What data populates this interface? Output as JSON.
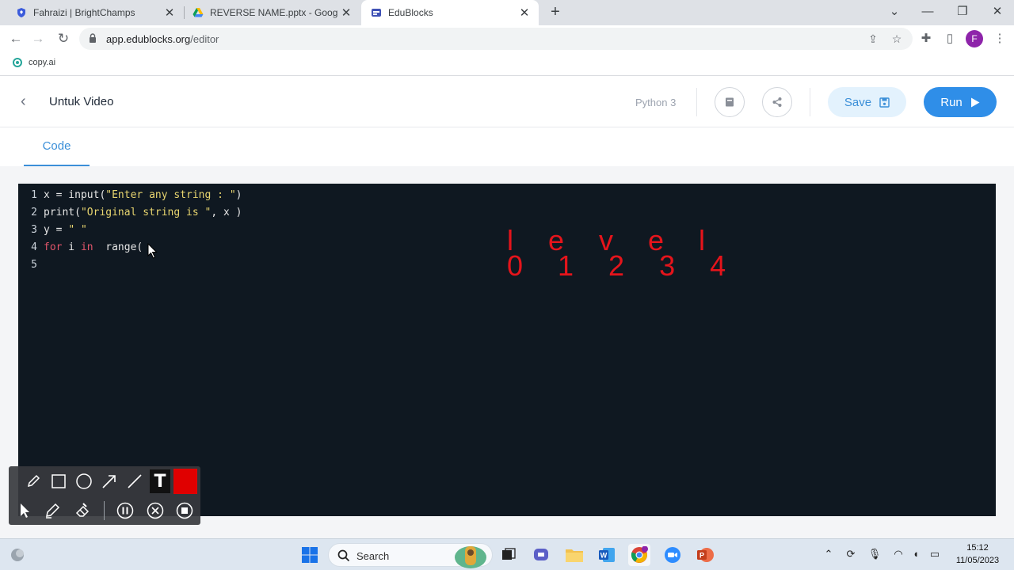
{
  "browser": {
    "tabs": [
      {
        "title": "Fahraizi | BrightChamps",
        "icon": "shield-icon",
        "active": false
      },
      {
        "title": "REVERSE NAME.pptx - Google Dr",
        "icon": "google-drive-icon",
        "active": false
      },
      {
        "title": "EduBlocks",
        "icon": "edublocks-icon",
        "active": true
      }
    ],
    "url_host": "app.edublocks.org",
    "url_path": "/editor",
    "profile_initial": "F",
    "bookmarks": [
      {
        "label": "copy.ai",
        "icon": "copyai-icon"
      }
    ]
  },
  "app": {
    "project_title": "Untuk Video",
    "language": "Python 3",
    "save_label": "Save",
    "run_label": "Run",
    "tabs": [
      {
        "label": "Code",
        "active": true
      }
    ],
    "accent_color": "#2f8ee8"
  },
  "editor": {
    "lines": [
      {
        "num": "1",
        "tokens": [
          {
            "t": "x = input(",
            "c": "plain"
          },
          {
            "t": "\"Enter any string : \"",
            "c": "str"
          },
          {
            "t": ")",
            "c": "plain"
          }
        ]
      },
      {
        "num": "2",
        "tokens": [
          {
            "t": "print(",
            "c": "plain"
          },
          {
            "t": "\"Original string is \"",
            "c": "str"
          },
          {
            "t": ", x )",
            "c": "plain"
          }
        ]
      },
      {
        "num": "3",
        "tokens": [
          {
            "t": "y = ",
            "c": "plain"
          },
          {
            "t": "\" \"",
            "c": "str"
          }
        ]
      },
      {
        "num": "4",
        "tokens": [
          {
            "t": "for",
            "c": "kw"
          },
          {
            "t": " i ",
            "c": "plain"
          },
          {
            "t": "in",
            "c": "kw"
          },
          {
            "t": "  range(",
            "c": "plain"
          }
        ]
      },
      {
        "num": "5",
        "tokens": []
      }
    ]
  },
  "annotation": {
    "word": "l e v e l",
    "indices": "0 1 2 3 4",
    "color": "#e5141b"
  },
  "draw_toolbar": {
    "tools_row1": [
      "pencil-icon",
      "rectangle-icon",
      "circle-icon",
      "arrow-icon",
      "line-icon",
      "text-icon",
      "color-swatch"
    ],
    "tools_row2": [
      "pointer-icon",
      "highlighter-icon",
      "eraser-icon",
      "pause-icon",
      "cancel-icon",
      "stop-icon"
    ],
    "text_tool_label": "T",
    "swatch_color": "#e00000"
  },
  "taskbar": {
    "search_label": "Search",
    "time": "15:12",
    "date": "11/05/2023"
  }
}
